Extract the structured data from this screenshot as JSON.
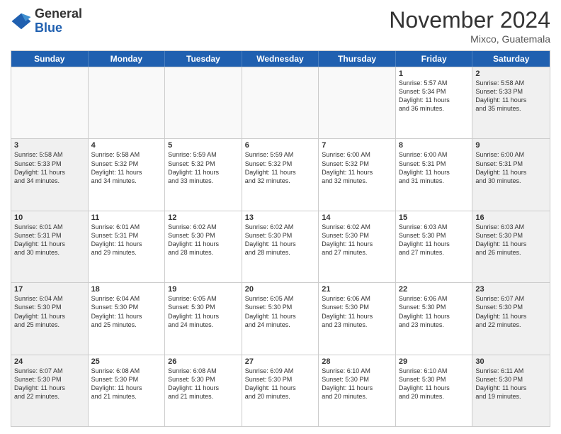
{
  "header": {
    "logo_general": "General",
    "logo_blue": "Blue",
    "month_title": "November 2024",
    "location": "Mixco, Guatemala"
  },
  "days_of_week": [
    "Sunday",
    "Monday",
    "Tuesday",
    "Wednesday",
    "Thursday",
    "Friday",
    "Saturday"
  ],
  "rows": [
    [
      {
        "day": "",
        "empty": true
      },
      {
        "day": "",
        "empty": true
      },
      {
        "day": "",
        "empty": true
      },
      {
        "day": "",
        "empty": true
      },
      {
        "day": "",
        "empty": true
      },
      {
        "day": "1",
        "lines": [
          "Sunrise: 5:57 AM",
          "Sunset: 5:34 PM",
          "Daylight: 11 hours",
          "and 36 minutes."
        ]
      },
      {
        "day": "2",
        "lines": [
          "Sunrise: 5:58 AM",
          "Sunset: 5:33 PM",
          "Daylight: 11 hours",
          "and 35 minutes."
        ]
      }
    ],
    [
      {
        "day": "3",
        "lines": [
          "Sunrise: 5:58 AM",
          "Sunset: 5:33 PM",
          "Daylight: 11 hours",
          "and 34 minutes."
        ]
      },
      {
        "day": "4",
        "lines": [
          "Sunrise: 5:58 AM",
          "Sunset: 5:32 PM",
          "Daylight: 11 hours",
          "and 34 minutes."
        ]
      },
      {
        "day": "5",
        "lines": [
          "Sunrise: 5:59 AM",
          "Sunset: 5:32 PM",
          "Daylight: 11 hours",
          "and 33 minutes."
        ]
      },
      {
        "day": "6",
        "lines": [
          "Sunrise: 5:59 AM",
          "Sunset: 5:32 PM",
          "Daylight: 11 hours",
          "and 32 minutes."
        ]
      },
      {
        "day": "7",
        "lines": [
          "Sunrise: 6:00 AM",
          "Sunset: 5:32 PM",
          "Daylight: 11 hours",
          "and 32 minutes."
        ]
      },
      {
        "day": "8",
        "lines": [
          "Sunrise: 6:00 AM",
          "Sunset: 5:31 PM",
          "Daylight: 11 hours",
          "and 31 minutes."
        ]
      },
      {
        "day": "9",
        "lines": [
          "Sunrise: 6:00 AM",
          "Sunset: 5:31 PM",
          "Daylight: 11 hours",
          "and 30 minutes."
        ]
      }
    ],
    [
      {
        "day": "10",
        "lines": [
          "Sunrise: 6:01 AM",
          "Sunset: 5:31 PM",
          "Daylight: 11 hours",
          "and 30 minutes."
        ]
      },
      {
        "day": "11",
        "lines": [
          "Sunrise: 6:01 AM",
          "Sunset: 5:31 PM",
          "Daylight: 11 hours",
          "and 29 minutes."
        ]
      },
      {
        "day": "12",
        "lines": [
          "Sunrise: 6:02 AM",
          "Sunset: 5:30 PM",
          "Daylight: 11 hours",
          "and 28 minutes."
        ]
      },
      {
        "day": "13",
        "lines": [
          "Sunrise: 6:02 AM",
          "Sunset: 5:30 PM",
          "Daylight: 11 hours",
          "and 28 minutes."
        ]
      },
      {
        "day": "14",
        "lines": [
          "Sunrise: 6:02 AM",
          "Sunset: 5:30 PM",
          "Daylight: 11 hours",
          "and 27 minutes."
        ]
      },
      {
        "day": "15",
        "lines": [
          "Sunrise: 6:03 AM",
          "Sunset: 5:30 PM",
          "Daylight: 11 hours",
          "and 27 minutes."
        ]
      },
      {
        "day": "16",
        "lines": [
          "Sunrise: 6:03 AM",
          "Sunset: 5:30 PM",
          "Daylight: 11 hours",
          "and 26 minutes."
        ]
      }
    ],
    [
      {
        "day": "17",
        "lines": [
          "Sunrise: 6:04 AM",
          "Sunset: 5:30 PM",
          "Daylight: 11 hours",
          "and 25 minutes."
        ]
      },
      {
        "day": "18",
        "lines": [
          "Sunrise: 6:04 AM",
          "Sunset: 5:30 PM",
          "Daylight: 11 hours",
          "and 25 minutes."
        ]
      },
      {
        "day": "19",
        "lines": [
          "Sunrise: 6:05 AM",
          "Sunset: 5:30 PM",
          "Daylight: 11 hours",
          "and 24 minutes."
        ]
      },
      {
        "day": "20",
        "lines": [
          "Sunrise: 6:05 AM",
          "Sunset: 5:30 PM",
          "Daylight: 11 hours",
          "and 24 minutes."
        ]
      },
      {
        "day": "21",
        "lines": [
          "Sunrise: 6:06 AM",
          "Sunset: 5:30 PM",
          "Daylight: 11 hours",
          "and 23 minutes."
        ]
      },
      {
        "day": "22",
        "lines": [
          "Sunrise: 6:06 AM",
          "Sunset: 5:30 PM",
          "Daylight: 11 hours",
          "and 23 minutes."
        ]
      },
      {
        "day": "23",
        "lines": [
          "Sunrise: 6:07 AM",
          "Sunset: 5:30 PM",
          "Daylight: 11 hours",
          "and 22 minutes."
        ]
      }
    ],
    [
      {
        "day": "24",
        "lines": [
          "Sunrise: 6:07 AM",
          "Sunset: 5:30 PM",
          "Daylight: 11 hours",
          "and 22 minutes."
        ]
      },
      {
        "day": "25",
        "lines": [
          "Sunrise: 6:08 AM",
          "Sunset: 5:30 PM",
          "Daylight: 11 hours",
          "and 21 minutes."
        ]
      },
      {
        "day": "26",
        "lines": [
          "Sunrise: 6:08 AM",
          "Sunset: 5:30 PM",
          "Daylight: 11 hours",
          "and 21 minutes."
        ]
      },
      {
        "day": "27",
        "lines": [
          "Sunrise: 6:09 AM",
          "Sunset: 5:30 PM",
          "Daylight: 11 hours",
          "and 20 minutes."
        ]
      },
      {
        "day": "28",
        "lines": [
          "Sunrise: 6:10 AM",
          "Sunset: 5:30 PM",
          "Daylight: 11 hours",
          "and 20 minutes."
        ]
      },
      {
        "day": "29",
        "lines": [
          "Sunrise: 6:10 AM",
          "Sunset: 5:30 PM",
          "Daylight: 11 hours",
          "and 20 minutes."
        ]
      },
      {
        "day": "30",
        "lines": [
          "Sunrise: 6:11 AM",
          "Sunset: 5:30 PM",
          "Daylight: 11 hours",
          "and 19 minutes."
        ]
      }
    ]
  ]
}
